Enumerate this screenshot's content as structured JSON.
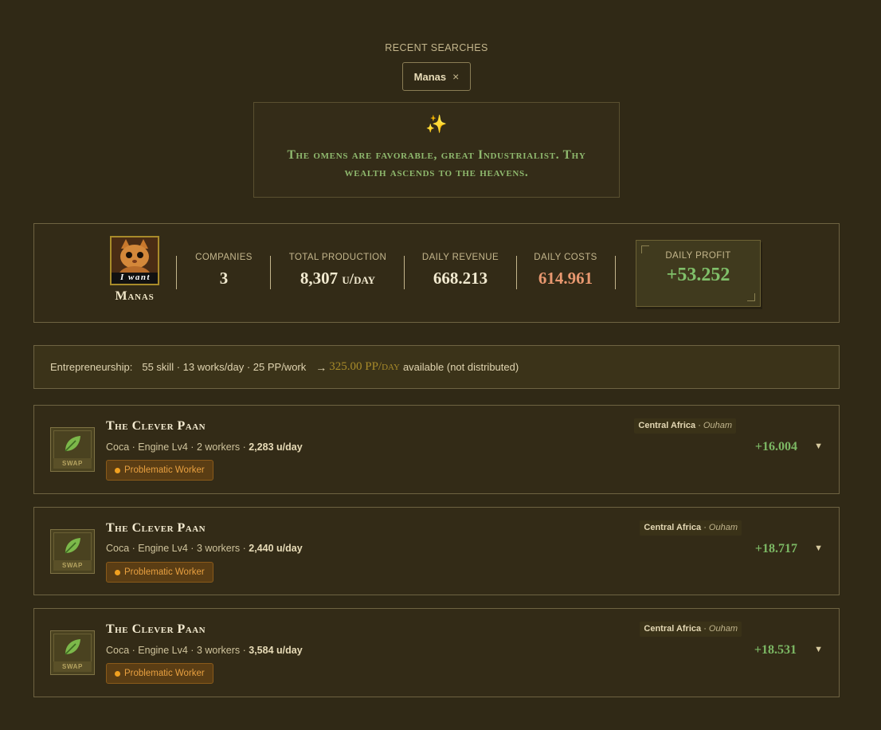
{
  "recent_searches": {
    "label": "RECENT SEARCHES",
    "chips": [
      {
        "text": "Manas",
        "remove": "×"
      }
    ]
  },
  "omen": {
    "icon": "sparkles-icon",
    "glyph": "✨",
    "message": "The omens are favorable, great Industrialist. Thy wealth ascends to the heavens."
  },
  "summary": {
    "player_name": "Manas",
    "avatar_caption": "I want",
    "companies": {
      "label": "COMPANIES",
      "value": "3"
    },
    "total_production": {
      "label": "TOTAL PRODUCTION",
      "value": "8,307",
      "unit": "u/day"
    },
    "daily_revenue": {
      "label": "DAILY REVENUE",
      "value": "668.213"
    },
    "daily_costs": {
      "label": "DAILY COSTS",
      "value": "614.961"
    },
    "daily_profit": {
      "label": "DAILY PROFIT",
      "value": "+53.252"
    }
  },
  "entrepreneurship": {
    "label": "Entrepreneurship:",
    "details": "55 skill · 13 works/day · 25 PP/work",
    "arrow": "→",
    "pp_value": "325.00",
    "pp_unit": "PP/day",
    "suffix": "available (not distributed)"
  },
  "companies": [
    {
      "name": "The Clever Paan",
      "product": "Coca · Engine Lv4 · 2 workers · ",
      "production": "2,283 u/day",
      "tag": "Problematic Worker",
      "region": "Central Africa",
      "sep": " · ",
      "city": "Ouham",
      "profit": "+16.004",
      "swap": "SWAP",
      "caret": "▼"
    },
    {
      "name": "The Clever Paan",
      "product": "Coca · Engine Lv4 · 3 workers · ",
      "production": "2,440 u/day",
      "tag": "Problematic Worker",
      "region": "Central Africa",
      "sep": " · ",
      "city": "Ouham",
      "profit": "+18.717",
      "swap": "SWAP",
      "caret": "▼"
    },
    {
      "name": "The Clever Paan",
      "product": "Coca · Engine Lv4 · 3 workers · ",
      "production": "3,584 u/day",
      "tag": "Problematic Worker",
      "region": "Central Africa",
      "sep": " · ",
      "city": "Ouham",
      "profit": "+18.531",
      "swap": "SWAP",
      "caret": "▼"
    }
  ],
  "colors": {
    "background": "#302916",
    "profit_green": "#80c06a",
    "cost_orange": "#e89870",
    "omen_green": "#8fb96e",
    "gold": "#a88b2a",
    "warning_orange": "#e8a040"
  }
}
